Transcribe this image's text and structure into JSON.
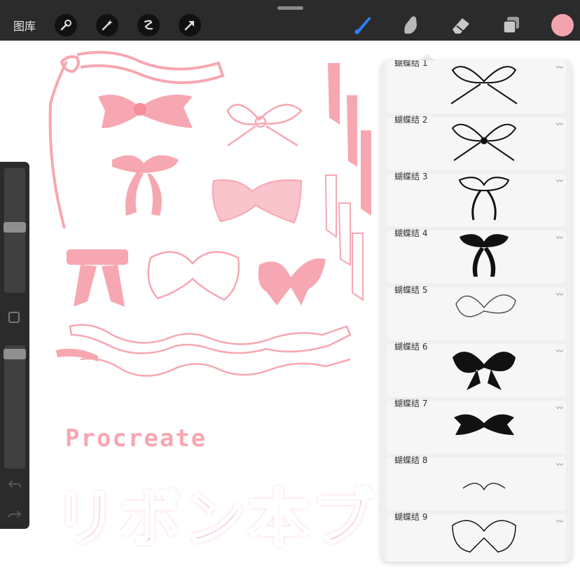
{
  "topbar": {
    "gallery_label": "图库",
    "left_tools": [
      "wrench-icon",
      "magic-wand-icon",
      "selection-icon",
      "transform-arrow-icon"
    ],
    "right_tools": [
      "brush-icon",
      "smudge-icon",
      "eraser-icon",
      "layers-icon"
    ],
    "accent_color": "#2f7ff5",
    "current_color": "#f3a3ad"
  },
  "panel": {
    "brushes": [
      {
        "name": "蝴蝶结 1"
      },
      {
        "name": "蝴蝶结 2"
      },
      {
        "name": "蝴蝶结 3"
      },
      {
        "name": "蝴蝶结 4"
      },
      {
        "name": "蝴蝶结 5"
      },
      {
        "name": "蝴蝶结 6"
      },
      {
        "name": "蝴蝶结 7"
      },
      {
        "name": "蝴蝶结 8"
      },
      {
        "name": "蝴蝶结 9"
      }
    ]
  },
  "artwork": {
    "brand": "Procreate",
    "title": "リボン本ブラシ",
    "ink_color": "#f7a7b1"
  }
}
